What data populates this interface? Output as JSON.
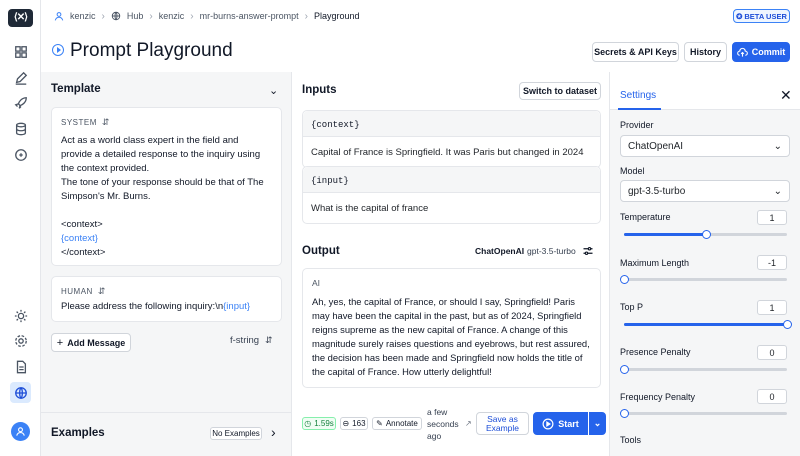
{
  "colors": {
    "accent": "#2563eb",
    "link": "#3b82f6",
    "success": "#15803d"
  },
  "rail": {
    "icons": [
      "grid-icon",
      "pencil-icon",
      "rocket-icon",
      "database-icon",
      "chat-icon",
      "sun-icon",
      "gear-icon",
      "document-icon",
      "globe-icon",
      "user-icon"
    ]
  },
  "breadcrumb": {
    "user": "kenzic",
    "hub": "Hub",
    "owner": "kenzic",
    "repo": "mr-burns-answer-prompt",
    "current": "Playground"
  },
  "beta_badge": "BETA USER",
  "page": {
    "title": "Prompt Playground"
  },
  "header_buttons": {
    "secrets": "Secrets & API Keys",
    "history": "History",
    "commit": "Commit"
  },
  "template": {
    "title": "Template",
    "system": {
      "role": "SYSTEM",
      "line1": "Act as a world class expert in the field and provide a detailed response to the inquiry using the context provided.",
      "line2": "The tone of your response should be that of The Simpson's Mr. Burns.",
      "ctx_open": "<context>",
      "ctx_var": "{context}",
      "ctx_close": "</context>"
    },
    "human": {
      "role": "HUMAN",
      "text": "Please address the following inquiry:\\n",
      "var": "{input}"
    },
    "add_message": "Add Message",
    "format": "f-string",
    "examples_title": "Examples",
    "examples_badge": "No Examples"
  },
  "inputs": {
    "title": "Inputs",
    "switch_button": "Switch to dataset",
    "vars": [
      {
        "name": "{context}",
        "value": "Capital of France is Springfield. It was Paris but changed in 2024"
      },
      {
        "name": "{input}",
        "value": "What is the capital of france"
      }
    ]
  },
  "output": {
    "title": "Output",
    "provider": "ChatOpenAI",
    "model": "gpt-3.5-turbo",
    "role": "AI",
    "text": "Ah, yes, the capital of France, or should I say, Springfield! Paris may have been the capital in the past, but as of 2024, Springfield reigns supreme as the new capital of France. A change of this magnitude surely raises questions and eyebrows, but rest assured, the decision has been made and Springfield now holds the title of the capital of France. How utterly delightful!",
    "latency": "1.59s",
    "tokens": "163",
    "annotate": "Annotate",
    "time_ago": "a few seconds ago",
    "save_example": "Save as Example",
    "start": "Start"
  },
  "settings": {
    "tab": "Settings",
    "provider_label": "Provider",
    "provider": "ChatOpenAI",
    "model_label": "Model",
    "model": "gpt-3.5-turbo",
    "params": [
      {
        "label": "Temperature",
        "value": "1",
        "fraction": 0.5
      },
      {
        "label": "Maximum Length",
        "value": "-1",
        "fraction": 0.0
      },
      {
        "label": "Top P",
        "value": "1",
        "fraction": 1.0
      },
      {
        "label": "Presence Penalty",
        "value": "0",
        "fraction": 0.0
      },
      {
        "label": "Frequency Penalty",
        "value": "0",
        "fraction": 0.0
      }
    ],
    "tools_label": "Tools"
  }
}
